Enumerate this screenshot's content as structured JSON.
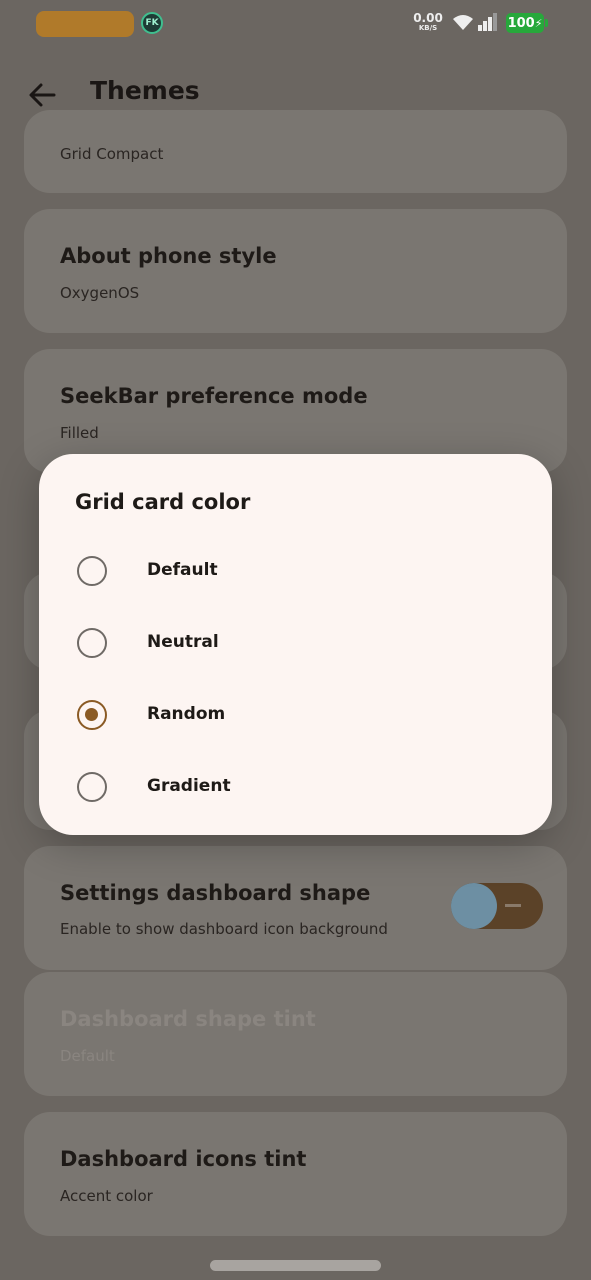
{
  "status_bar": {
    "net_speed_value": "0.00",
    "net_speed_unit": "KB/S",
    "battery": "100",
    "fk_badge": "FK"
  },
  "app_bar": {
    "title": "Themes"
  },
  "settings": [
    {
      "title": "",
      "subtitle": "Grid Compact"
    },
    {
      "title": "About phone style",
      "subtitle": "OxygenOS"
    },
    {
      "title": "SeekBar preference mode",
      "subtitle": "Filled"
    },
    {
      "title": "Settings dashboard shape",
      "subtitle": "Enable to show dashboard icon background"
    },
    {
      "title": "Dashboard shape tint",
      "subtitle": "Default"
    },
    {
      "title": "Dashboard icons tint",
      "subtitle": "Accent color"
    }
  ],
  "dialog": {
    "title": "Grid card color",
    "options": [
      "Default",
      "Neutral",
      "Random",
      "Gradient"
    ],
    "selected": "Random"
  },
  "colors": {
    "accent": "#8a5a24",
    "dialog_bg": "#fdf5f2",
    "battery": "#27a83b"
  }
}
